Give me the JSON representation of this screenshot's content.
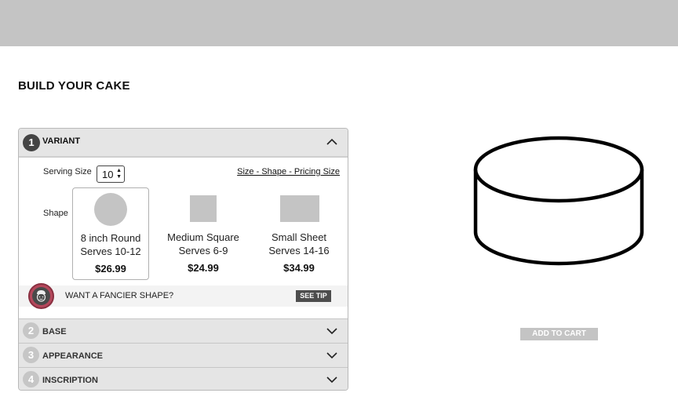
{
  "page": {
    "title": "BUILD YOUR CAKE"
  },
  "variant": {
    "step": "1",
    "label": "VARIANT",
    "serving_label": "Serving Size",
    "serving_value": "10",
    "pricing_link": "Size - Shape - Pricing Size",
    "shape_label": "Shape",
    "options": [
      {
        "name": "8 inch Round",
        "serves": "Serves 10-12",
        "price": "$26.99",
        "selected": true,
        "icon": "round-shape"
      },
      {
        "name": "Medium Square",
        "serves": "Serves 6-9",
        "price": "$24.99",
        "selected": false,
        "icon": "square-shape"
      },
      {
        "name": "Small Sheet",
        "serves": "Serves 14-16",
        "price": "$34.99",
        "selected": false,
        "icon": "sheet-shape"
      }
    ],
    "tip_text": "WANT A FANCIER SHAPE?",
    "tip_button": "SEE TIP"
  },
  "sections": [
    {
      "step": "2",
      "label": "BASE"
    },
    {
      "step": "3",
      "label": "APPEARANCE"
    },
    {
      "step": "4",
      "label": "INSCRIPTION"
    }
  ],
  "cart": {
    "label": "ADD TO CART"
  },
  "colors": {
    "topbar": "#c4c4c4",
    "panel_header": "#e5e5e5",
    "active_step": "#444444",
    "inactive_step": "#c6c6c6",
    "placeholder": "#c4c4c4",
    "avatar": "#b5485c"
  }
}
